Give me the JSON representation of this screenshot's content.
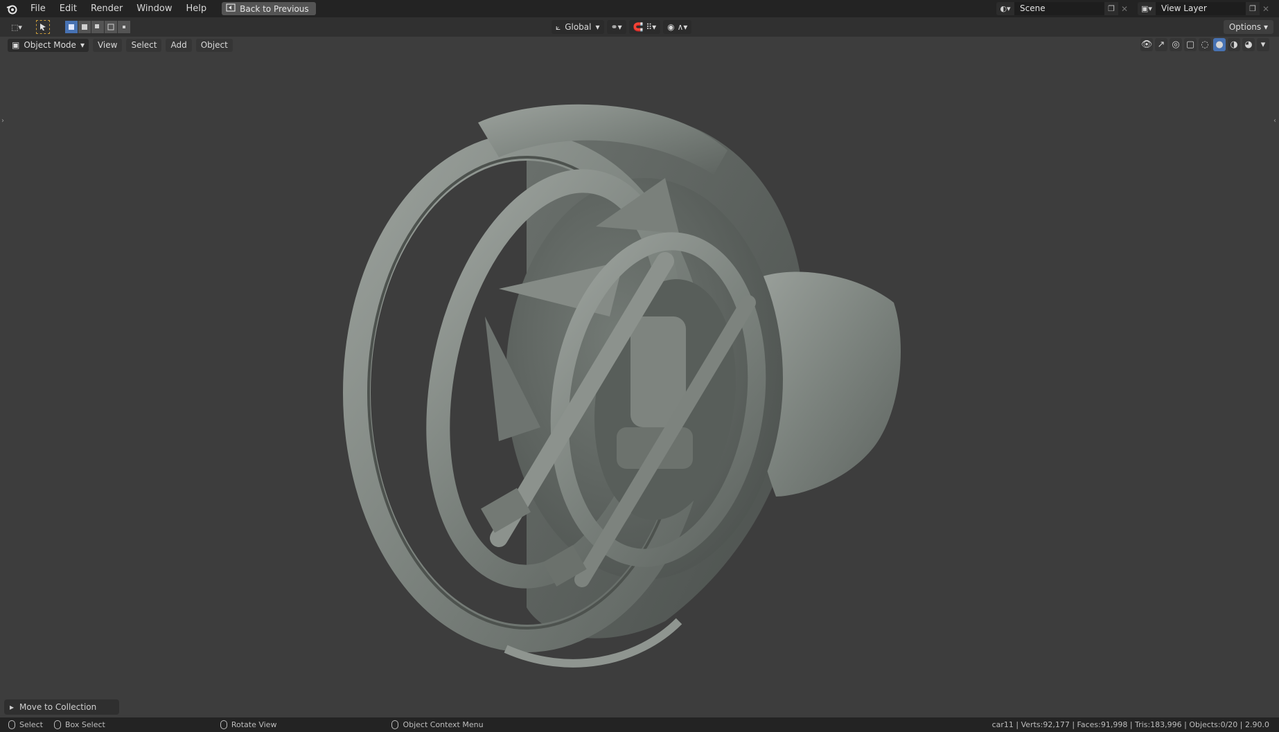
{
  "topbar": {
    "menus": [
      "File",
      "Edit",
      "Render",
      "Window",
      "Help"
    ],
    "back_label": "Back to Previous",
    "scene_value": "Scene",
    "viewlayer_value": "View Layer"
  },
  "toolheader": {
    "orientation": "Global",
    "options_label": "Options"
  },
  "viewport_header": {
    "mode": "Object Mode",
    "menus": [
      "View",
      "Select",
      "Add",
      "Object"
    ]
  },
  "operator_panel": {
    "label": "Move to Collection"
  },
  "statusbar": {
    "select": "Select",
    "box_select": "Box Select",
    "rotate_view": "Rotate View",
    "context_menu": "Object Context Menu",
    "stats": "car11 | Verts:92,177 | Faces:91,998 | Tris:183,996 | Objects:0/20 | 2.90.0"
  },
  "colors": {
    "accent": "#4772b3",
    "viewport_bg": "#3d3d3d",
    "header_bg": "#232323",
    "model": "#7f8680"
  },
  "icons": [
    "blender-logo",
    "back-icon",
    "scene-icon",
    "view-layer-icon",
    "editor-type-icon",
    "select-cursor-icon",
    "select-mode-icons",
    "transform-orientation-icon",
    "pivot-icon",
    "snap-icon",
    "proportional-icon",
    "mode-icon",
    "visibility-icon",
    "gizmo-icon",
    "overlay-icon",
    "xray-icon",
    "shading-wire-icon",
    "shading-solid-icon",
    "shading-material-icon",
    "shading-render-icon",
    "mouse-icon"
  ]
}
